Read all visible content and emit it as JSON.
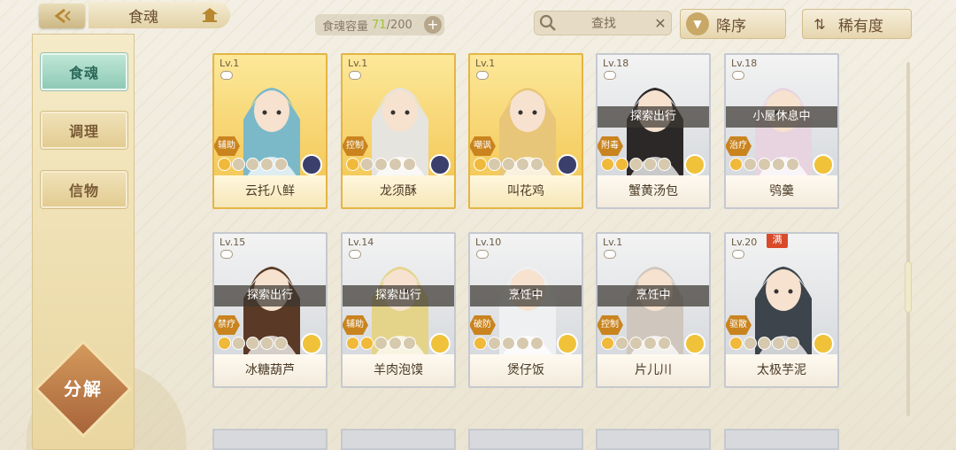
{
  "header": {
    "title": "食魂",
    "capacity_label": "食魂容量",
    "capacity_current": "71",
    "capacity_total": "/200",
    "add_label": "+",
    "search_text": "查找",
    "clear_label": "✕",
    "sort_order_label": "降序",
    "sort_by_label": "稀有度"
  },
  "sidebar": {
    "tabs": [
      {
        "label": "食魂",
        "active": true
      },
      {
        "label": "调理",
        "active": false
      },
      {
        "label": "信物",
        "active": false
      }
    ],
    "decompose_label": "分解"
  },
  "cards": [
    {
      "lv": "Lv.1",
      "name": "云托八鲜",
      "role": "辅助",
      "rarity": "gold",
      "status": "",
      "stars": 1,
      "element_color": "#3b3f6b",
      "hair": "#7bb9c9"
    },
    {
      "lv": "Lv.1",
      "name": "龙须酥",
      "role": "控制",
      "rarity": "gold",
      "status": "",
      "stars": 1,
      "element_color": "#3b3f6b",
      "hair": "#e6e4de"
    },
    {
      "lv": "Lv.1",
      "name": "叫花鸡",
      "role": "嘲讽",
      "rarity": "gold",
      "status": "",
      "stars": 1,
      "element_color": "#3b3f6b",
      "hair": "#e8c679"
    },
    {
      "lv": "Lv.18",
      "name": "蟹黄汤包",
      "role": "附毒",
      "rarity": "silver",
      "status": "探索出行",
      "stars": 2,
      "element_color": "#f0c23a",
      "hair": "#2c2828"
    },
    {
      "lv": "Lv.18",
      "name": "鸮羹",
      "role": "治疗",
      "rarity": "silver",
      "status": "小屋休息中",
      "stars": 1,
      "element_color": "#f0c23a",
      "hair": "#e8d4e0"
    },
    {
      "lv": "Lv.15",
      "name": "冰糖葫芦",
      "role": "禁疗",
      "rarity": "silver",
      "status": "探索出行",
      "stars": 1,
      "element_color": "#f0c23a",
      "hair": "#5a3a26"
    },
    {
      "lv": "Lv.14",
      "name": "羊肉泡馍",
      "role": "辅助",
      "rarity": "silver",
      "status": "探索出行",
      "stars": 2,
      "element_color": "#f0c23a",
      "hair": "#e4d48a"
    },
    {
      "lv": "Lv.10",
      "name": "煲仔饭",
      "role": "破防",
      "rarity": "silver",
      "status": "烹饪中",
      "stars": 1,
      "element_color": "#f0c23a",
      "hair": "#eef0f2"
    },
    {
      "lv": "Lv.1",
      "name": "片儿川",
      "role": "控制",
      "rarity": "silver",
      "status": "烹饪中",
      "stars": 1,
      "element_color": "#f0c23a",
      "hair": "#cfc6bd"
    },
    {
      "lv": "Lv.20",
      "name": "太极芋泥",
      "role": "驱散",
      "rarity": "silver",
      "status": "",
      "stars": 1,
      "element_color": "#f0c23a",
      "hair": "#3e444c",
      "full_badge": "满"
    }
  ]
}
